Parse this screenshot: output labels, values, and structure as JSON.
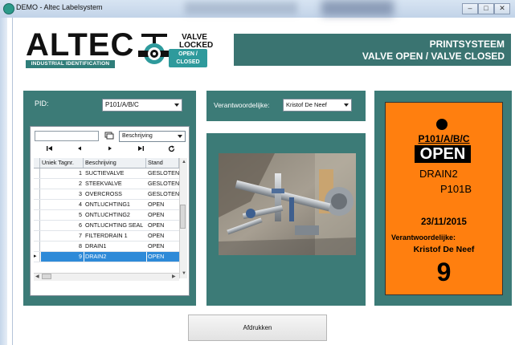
{
  "window": {
    "title": "DEMO - Altec Labelsystem",
    "minimize": "–",
    "maximize": "□",
    "close": "✕"
  },
  "header": {
    "logo_text": "ALTEC",
    "logo_sub": "INDUSTRIAL IDENTIFICATION",
    "valve_locked": "VALVE LOCKED",
    "open_closed": "OPEN / CLOSED",
    "banner_line1": "PRINTSYSTEEM",
    "banner_line2": "VALVE OPEN / VALVE CLOSED"
  },
  "form": {
    "pid_label": "PID:",
    "pid_value": "P101/A/B/C",
    "verantw_label": "Verantwoordelijke:",
    "verantw_value": "Kristof De Neef"
  },
  "grid": {
    "search_placeholder": "",
    "column_select": "Beschrijving",
    "nav": {
      "first": "⏮",
      "prev": "◀",
      "next": "▶",
      "last": "⏭",
      "refresh": "↻"
    },
    "columns": [
      "Uniek Tagnr.",
      "Beschrijving",
      "Stand"
    ],
    "rows": [
      {
        "nr": "1",
        "desc": "SUCTIEVALVE",
        "stand": "GESLOTEN"
      },
      {
        "nr": "2",
        "desc": "STEEKVALVE",
        "stand": "GESLOTEN"
      },
      {
        "nr": "3",
        "desc": "OVERCROSS",
        "stand": "GESLOTEN"
      },
      {
        "nr": "4",
        "desc": "ONTLUCHTING1",
        "stand": "OPEN"
      },
      {
        "nr": "5",
        "desc": "ONTLUCHTING2",
        "stand": "OPEN"
      },
      {
        "nr": "6",
        "desc": "ONTLUCHTING SEAL",
        "stand": "OPEN"
      },
      {
        "nr": "7",
        "desc": "FILTERDRAIN   1",
        "stand": "OPEN"
      },
      {
        "nr": "8",
        "desc": "DRAIN1",
        "stand": "OPEN"
      },
      {
        "nr": "9",
        "desc": "DRAIN2",
        "stand": "OPEN"
      }
    ],
    "selected_row": 8
  },
  "label": {
    "pid": "P101/A/B/C",
    "status": "OPEN",
    "description": "DRAIN2",
    "tag": "P101B",
    "date": "23/11/2015",
    "verantw_label": "Verantwoordelijke:",
    "verantw_name": "Kristof De Neef",
    "number": "9"
  },
  "actions": {
    "print": "Afdrukken"
  },
  "colors": {
    "panel": "#3c7b77",
    "label_bg": "#ff7f0f",
    "selection": "#2e8ad8"
  }
}
